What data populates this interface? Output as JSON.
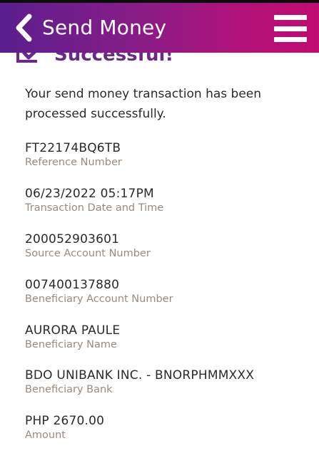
{
  "header": {
    "title": "Send Money",
    "back_icon": "chevron-left-icon",
    "menu_icon": "hamburger-menu-icon",
    "colors": {
      "gradient_start": "#5a1f8e",
      "gradient_end": "#c10c71"
    }
  },
  "status": {
    "text": "Successful!",
    "icon": "checklist-check-icon"
  },
  "message": "Your send money transaction has been processed successfully.",
  "details": [
    {
      "value": "FT22174BQ6TB",
      "label": "Reference Number"
    },
    {
      "value": "06/23/2022 05:17PM",
      "label": "Transaction Date and Time"
    },
    {
      "value": "200052903601",
      "label": "Source Account Number"
    },
    {
      "value": "007400137880",
      "label": "Beneficiary Account Number"
    },
    {
      "value": "AURORA PAULE",
      "label": "Beneficiary Name"
    },
    {
      "value": "BDO UNIBANK INC. - BNORPHMMXXX",
      "label": "Beneficiary Bank"
    },
    {
      "value": "PHP 2670.00",
      "label": "Amount"
    }
  ]
}
